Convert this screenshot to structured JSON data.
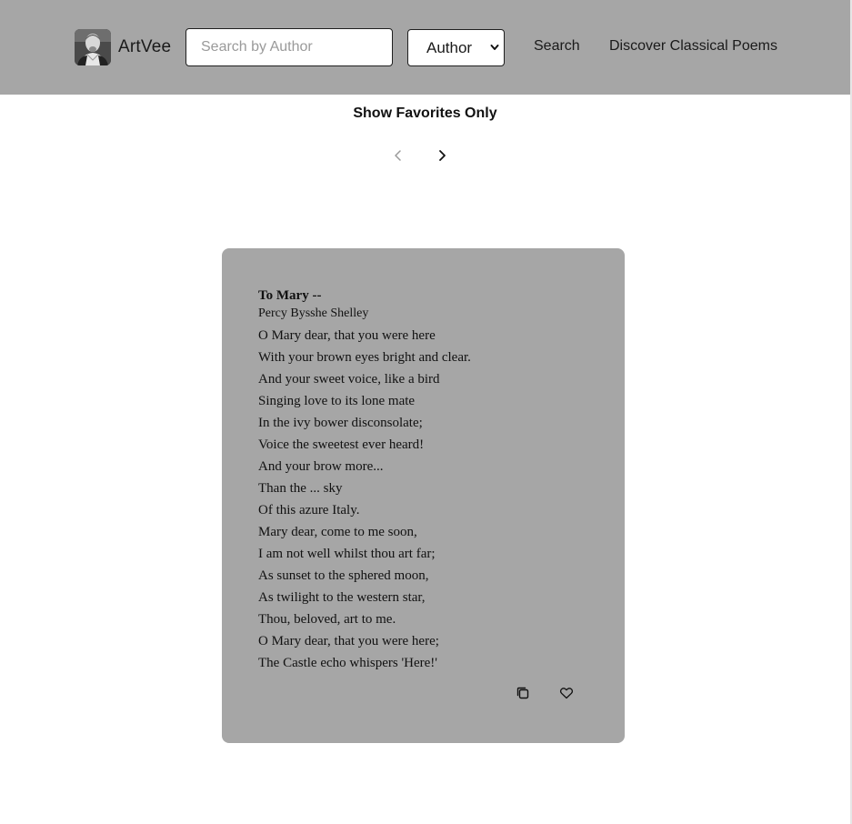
{
  "header": {
    "brand": "ArtVee",
    "search": {
      "placeholder": "Search by Author",
      "value": ""
    },
    "filter": {
      "selected": "Author"
    },
    "nav": {
      "search": "Search",
      "discover": "Discover Classical Poems"
    },
    "background": "#a6a6a6"
  },
  "controls": {
    "favorites_toggle": "Show Favorites Only",
    "prev_icon": "chevron-left-icon",
    "next_icon": "chevron-right-icon"
  },
  "poem": {
    "title": "To Mary --",
    "author": "Percy Bysshe Shelley",
    "lines": [
      "O Mary dear, that you were here",
      "With your brown eyes bright and clear.",
      "And your sweet voice, like a bird",
      "Singing love to its lone mate",
      "In the ivy bower disconsolate;",
      "Voice the sweetest ever heard!",
      "And your brow more...",
      "Than the ... sky",
      "Of this azure Italy.",
      "Mary dear, come to me soon,",
      "I am not well whilst thou art far;",
      "As sunset to the sphered moon,",
      "As twilight to the western star,",
      "Thou, beloved, art to me.",
      "O Mary dear, that you were here;",
      "The Castle echo whispers 'Here!'"
    ],
    "actions": {
      "copy_icon": "copy-icon",
      "favorite_icon": "heart-icon"
    },
    "card_color": "#a6a6a6"
  }
}
